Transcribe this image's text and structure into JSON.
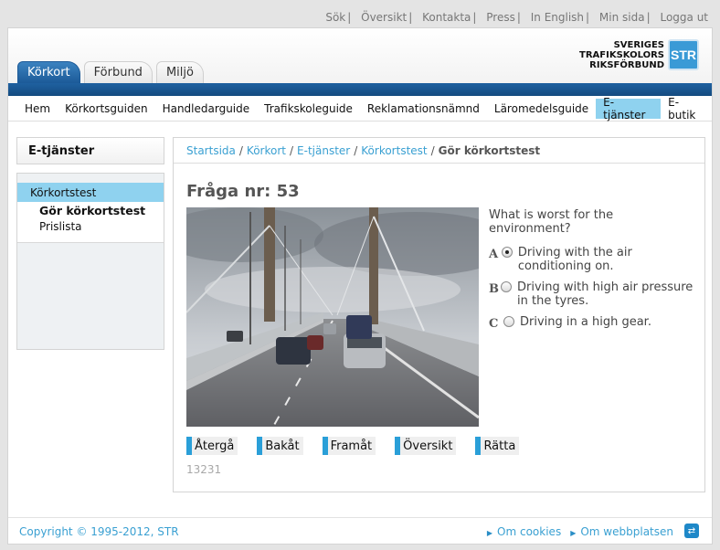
{
  "top_links": [
    "Sök",
    "Översikt",
    "Kontakta",
    "Press",
    "In English",
    "Min sida",
    "Logga ut"
  ],
  "logo": {
    "line1": "SVERIGES",
    "line2": "TRAFIKSKOLORS",
    "line3": "RIKSFÖRBUND",
    "mark": "STR"
  },
  "top_tabs": [
    "Körkort",
    "Förbund",
    "Miljö"
  ],
  "main_nav": [
    "Hem",
    "Körkortsguiden",
    "Handledarguide",
    "Trafikskoleguide",
    "Reklamationsnämnd",
    "Läromedelsguide",
    "E-tjänster",
    "E-butik"
  ],
  "sidebar": {
    "title": "E-tjänster",
    "menu_head": "Körkortstest",
    "items": [
      "Gör körkortstest",
      "Prislista"
    ]
  },
  "breadcrumb": {
    "items": [
      "Startsida",
      "Körkort",
      "E-tjänster",
      "Körkortstest"
    ],
    "current": "Gör körkortstest"
  },
  "question": {
    "title": "Fråga nr: 53",
    "text": "What is worst for the environment?",
    "options": [
      {
        "letter": "A",
        "label": "Driving with the air conditioning on.",
        "selected": true
      },
      {
        "letter": "B",
        "label": "Driving with high air pressure in the tyres.",
        "selected": false
      },
      {
        "letter": "C",
        "label": "Driving in a high gear.",
        "selected": false
      }
    ],
    "id": "13231"
  },
  "buttons": [
    "Återgå",
    "Bakåt",
    "Framåt",
    "Översikt",
    "Rätta"
  ],
  "footer": {
    "copyright": "Copyright © 1995-2012, STR",
    "links": [
      "Om cookies",
      "Om webbplatsen"
    ]
  },
  "colors": {
    "brand_blue": "#1f61a0",
    "accent_cyan": "#8fd2ef",
    "link": "#3aa0d2"
  }
}
